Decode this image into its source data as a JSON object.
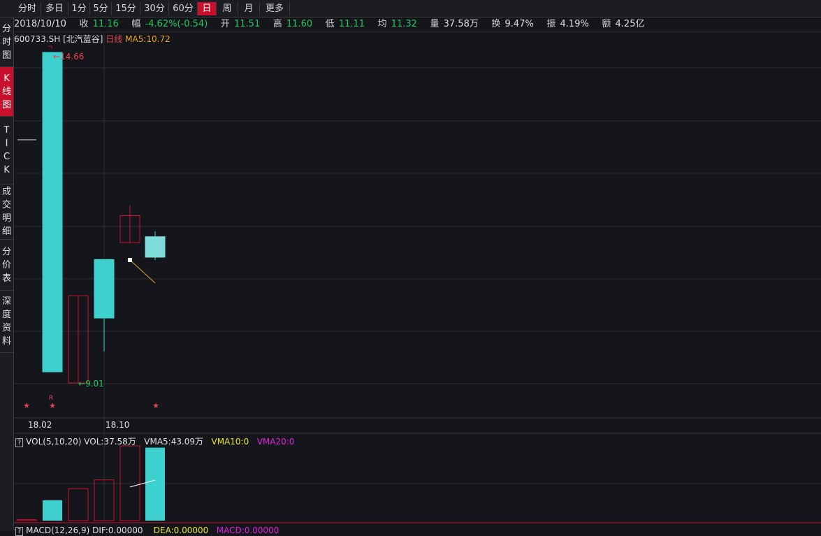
{
  "tabs": [
    {
      "label": "分时",
      "active": false
    },
    {
      "label": "多日",
      "active": false
    },
    {
      "label": "1分",
      "active": false
    },
    {
      "label": "5分",
      "active": false
    },
    {
      "label": "15分",
      "active": false
    },
    {
      "label": "30分",
      "active": false
    },
    {
      "label": "60分",
      "active": false
    },
    {
      "label": "日",
      "active": true
    },
    {
      "label": "周",
      "active": false
    },
    {
      "label": "月",
      "active": false
    },
    {
      "label": "更多",
      "active": false
    }
  ],
  "side_nav": [
    {
      "label": "分时图",
      "active": false
    },
    {
      "label": "K线图",
      "active": true
    },
    {
      "label": "TICK",
      "active": false
    },
    {
      "label": "成交明细",
      "active": false
    },
    {
      "label": "分价表",
      "active": false
    },
    {
      "label": "深度资料",
      "active": false
    }
  ],
  "quote": {
    "date": "2018/10/10",
    "close_label": "收",
    "close": "11.16",
    "change_label": "幅",
    "change": "-4.62%(-0.54)",
    "open_label": "开",
    "open": "11.51",
    "high_label": "高",
    "high": "11.60",
    "low_label": "低",
    "low": "11.11",
    "avg_label": "均",
    "avg": "11.32",
    "volume_label": "量",
    "volume": "37.58万",
    "turnover_label": "换",
    "turnover": "9.47%",
    "amplitude_label": "振",
    "amplitude": "4.19%",
    "amount_label": "额",
    "amount": "4.25亿"
  },
  "kline_header": {
    "symbol": "600733.SH [北汽蓝谷]",
    "period": "日线",
    "ma5": "MA5:10.72"
  },
  "annotations": {
    "max_price": "14.66",
    "min_price": "9.01",
    "marker_r": "R"
  },
  "x_axis": {
    "labels": [
      "18.02",
      "18.10"
    ]
  },
  "vol_header": {
    "help": "?",
    "vol_params": "VOL(5,10,20)",
    "vol": "VOL:37.58万",
    "vma5": "VMA5:43.09万",
    "vma10": "VMA10:0",
    "vma20": "VMA20:0"
  },
  "macd_header": {
    "help": "?",
    "macd_params": "MACD(12,26,9)",
    "dif": "DIF:0.00000",
    "dea": "DEA:0.00000",
    "macd": "MACD:0.00000"
  },
  "colors": {
    "up": "#c8102e",
    "down": "#3ecfcf",
    "accent": "#c8102e",
    "ma5": "#e8a317",
    "vma10": "#e6e62a",
    "vma20": "#e020e0"
  },
  "chart_data": {
    "type": "candlestick",
    "price_range": [
      9.01,
      14.66
    ],
    "candles": [
      {
        "open": 14.66,
        "high": 14.66,
        "low": 9.2,
        "close": 9.2,
        "dir": "down"
      },
      {
        "open": 9.01,
        "high": 10.5,
        "low": 9.01,
        "close": 10.5,
        "dir": "up"
      },
      {
        "open": 11.12,
        "high": 11.12,
        "low": 9.55,
        "close": 10.12,
        "dir": "down"
      },
      {
        "open": 11.41,
        "high": 12.05,
        "low": 11.41,
        "close": 11.87,
        "dir": "up"
      },
      {
        "open": 11.51,
        "high": 11.6,
        "low": 11.11,
        "close": 11.16,
        "dir": "down"
      }
    ],
    "volume": [
      {
        "value": 0.5,
        "dir": "up"
      },
      {
        "value": 10.5,
        "dir": "down"
      },
      {
        "value": 16.5,
        "dir": "up"
      },
      {
        "value": 21.0,
        "dir": "up"
      },
      {
        "value": 38.5,
        "dir": "up"
      },
      {
        "value": 37.58,
        "dir": "down"
      }
    ],
    "vol_range": [
      0,
      38.5
    ]
  }
}
